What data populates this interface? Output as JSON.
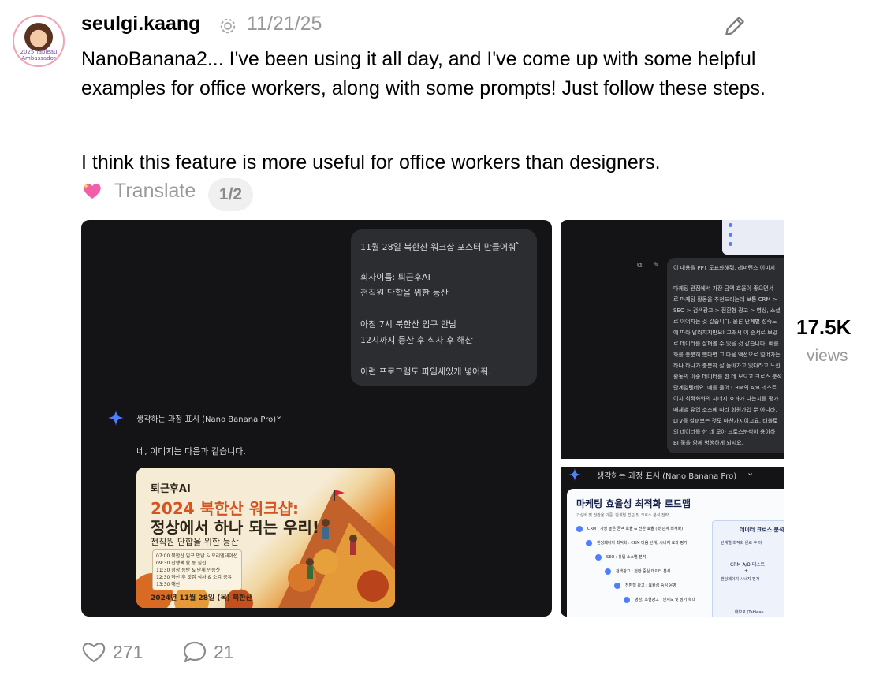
{
  "post": {
    "username": "seulgi.kaang",
    "date": "11/21/25",
    "avatar_ring_text": "2025 Tableau Ambassador",
    "paragraph1": "NanoBanana2... I've been using it all day, and I've come up with some helpful examples for office workers, along with some prompts! Just follow these steps.",
    "paragraph2": "I think this feature is more useful for office workers than designers.",
    "translate_label": "Translate",
    "pager": "1/2"
  },
  "stats": {
    "views_count": "17.5K",
    "views_label": "views"
  },
  "actions": {
    "likes": "271",
    "comments": "21"
  },
  "image1": {
    "prompt_title": "11월 28일 북한산 워크샵 포스터 만들어줘",
    "prompt_lines": [
      "회사이름: 퇴근후AI",
      "전직원 단합을 위한 등산",
      "아침 7시 북한산 입구 만남",
      "12시까지 등산 후 식사 후 해산",
      "이런 프로그램도 파임새있게 넣어줘."
    ],
    "thinking": "생각하는 과정 표시 (Nano Banana Pro)",
    "answer": "네, 이미지는 다음과 같습니다.",
    "poster": {
      "company": "퇴근후AI",
      "title1": "2024 북한산 워크샵:",
      "title2": "정상에서 하나 되는 우리!",
      "subtitle": "전직원 단합을 위한 등산",
      "schedule": [
        "07:00  북한산 입구 만남 & 오리엔테이션",
        "09:30  산행팩 활 동 심신",
        "11:30  정상 등반 & 단체 인증샷",
        "12:30  하산 후 맛집 식사 & 소감 공유",
        "13:30  해산"
      ],
      "date": "2024년 11월 28일 (목) 북한산"
    }
  },
  "image2": {
    "thinking": "생각하는 과정 표시 (Nano Banana Pro)",
    "text_lines": [
      "이 내용을 PPT 도표화해줘, 레퍼런스 이미지",
      "마케팅 관점에서 가장 금액 효율이 좋으면서",
      "로 마케팅 활동을 추천드리는데 보통 CRM >",
      "SEO > 검색광고 > 전환형 광고 > 영상, 소셜",
      "로 이어지는 것 같습니다. 물론 단계별 성숙도",
      "에 따라 달라지지만요! 그래서 이 순서로 보았",
      "로 데이터를 살펴볼 수 있을 것 같습니다. 예를",
      "화를 충분히 했다면 그 다음 액션으로 넘어가는",
      "하나 하나가 충분히 잘 돌아가고 있다라고 느낀",
      "활동의 이종 데이터를 한 데 모으고 크로스 분석",
      "단계일텐데요. 예를 들어 CRM의 A/B 테스트",
      "이지 최적화와의 시너지 효과가 나는지를 평가",
      "매체별 유입 소스에 따라 회원가입 뿐 아니라,",
      "LTV를 살펴보는 것도 마찬가지이고요. 태블로",
      "의 데이터를 한 데 모아 크로스분석이 용이하",
      "BI 툴을 함께 병행하게 되지요."
    ],
    "slide_title": "마케팅 효율성 최적화 로드맵",
    "slide_sub": "가성비 및 전환율 기준, 단계별 접근 및 크로스 분석 전략",
    "slide_right": "데이터 크로스 분석",
    "steps": [
      "CRM : 가장 높은 금액 효율 & 전환 효율 (첫 단계 최적화)",
      "랜딩페이지 최적화 : CRM 다음 단계, 시너지 효과 평가",
      "SEO : 유입 소스별 분석",
      "검색광고 : 전환 중심 데이터 분석",
      "전환형 광고 : 효율성 중심 운영",
      "영상, 소셜광고 : 인지도 및 장기 확대"
    ],
    "right_items": [
      "단계별 최적화 완료 후 이",
      "CRM A/B 테스트",
      "+",
      "랜딩페이지 시너지 평가",
      "대보로 (Tableau"
    ]
  },
  "colors": {
    "accent": "#4f7fff",
    "image_bg": "#141416",
    "muted": "#999999"
  }
}
